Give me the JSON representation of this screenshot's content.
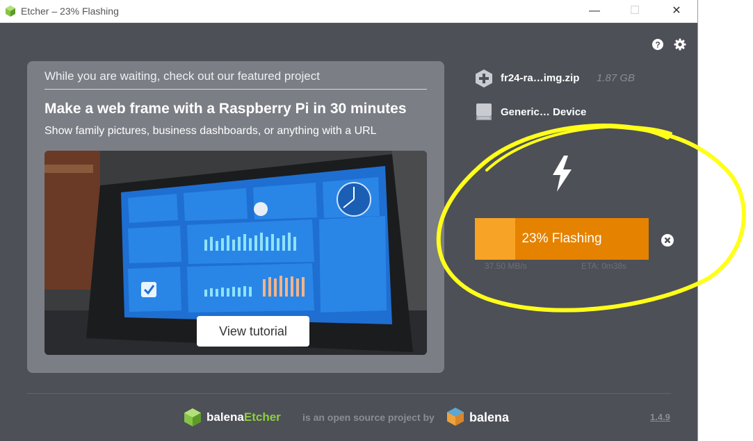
{
  "window": {
    "title": "Etcher – 23% Flashing"
  },
  "titlebar_icons": {
    "minimize": "minimize-icon",
    "maximize": "maximize-icon",
    "close": "close-icon"
  },
  "top_icons": {
    "help": "help-icon",
    "settings": "gear-icon"
  },
  "featured": {
    "intro": "While you are waiting, check out our featured project",
    "headline": "Make a web frame with a Raspberry Pi in 30 minutes",
    "subline": "Show family pictures, business dashboards, or anything with a URL",
    "button_label": "View tutorial"
  },
  "source": {
    "icon": "plus-hex-icon",
    "filename": "fr24-ra…img.zip",
    "size": "1.87 GB"
  },
  "target": {
    "icon": "drive-icon",
    "name": "Generic… Device"
  },
  "flash": {
    "icon": "lightning-icon",
    "label": "23% Flashing",
    "progress": 0.23,
    "speed": "37.50 MB/s",
    "eta": "ETA: 0m38s",
    "cancel_icon": "cancel-icon"
  },
  "footer": {
    "brand_prefix": "balena",
    "brand_suffix": "Etcher",
    "text": "is an open source project by",
    "company": "balena",
    "version": "1.4.9"
  },
  "colors": {
    "background": "#4d5057",
    "card": "#7b7e85",
    "progress_bg": "#e58200",
    "progress_fill": "#f7a326",
    "accent_green": "#8dcf3f",
    "annotation": "#ffff1a"
  }
}
